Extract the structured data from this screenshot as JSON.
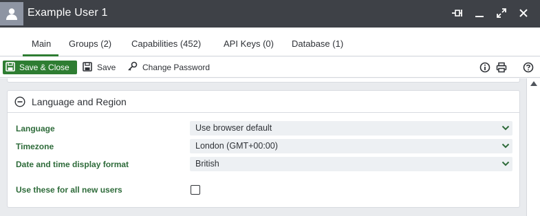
{
  "window": {
    "title": "Example User 1",
    "controls": [
      "pin-icon",
      "minimize-icon",
      "maximize-icon",
      "close-icon"
    ]
  },
  "tabs": [
    {
      "label": "Main",
      "active": true
    },
    {
      "label": "Groups (2)",
      "active": false
    },
    {
      "label": "Capabilities (452)",
      "active": false
    },
    {
      "label": "API Keys (0)",
      "active": false
    },
    {
      "label": "Database (1)",
      "active": false
    }
  ],
  "toolbar": {
    "save_close_label": "Save & Close",
    "save_label": "Save",
    "change_password_label": "Change Password",
    "right_icons": [
      "info-icon",
      "print-icon",
      "help-icon"
    ]
  },
  "panel": {
    "title": "Language and Region",
    "fields": {
      "language": {
        "label": "Language",
        "value": "Use browser default"
      },
      "timezone": {
        "label": "Timezone",
        "value": "London (GMT+00:00)"
      },
      "format": {
        "label": "Date and time display format",
        "value": "British"
      },
      "all_users": {
        "label": "Use these for all new users",
        "checked": false
      }
    }
  },
  "colors": {
    "titlebar": "#3e4147",
    "accent": "#2e7d32",
    "label": "#2e6b3a"
  }
}
